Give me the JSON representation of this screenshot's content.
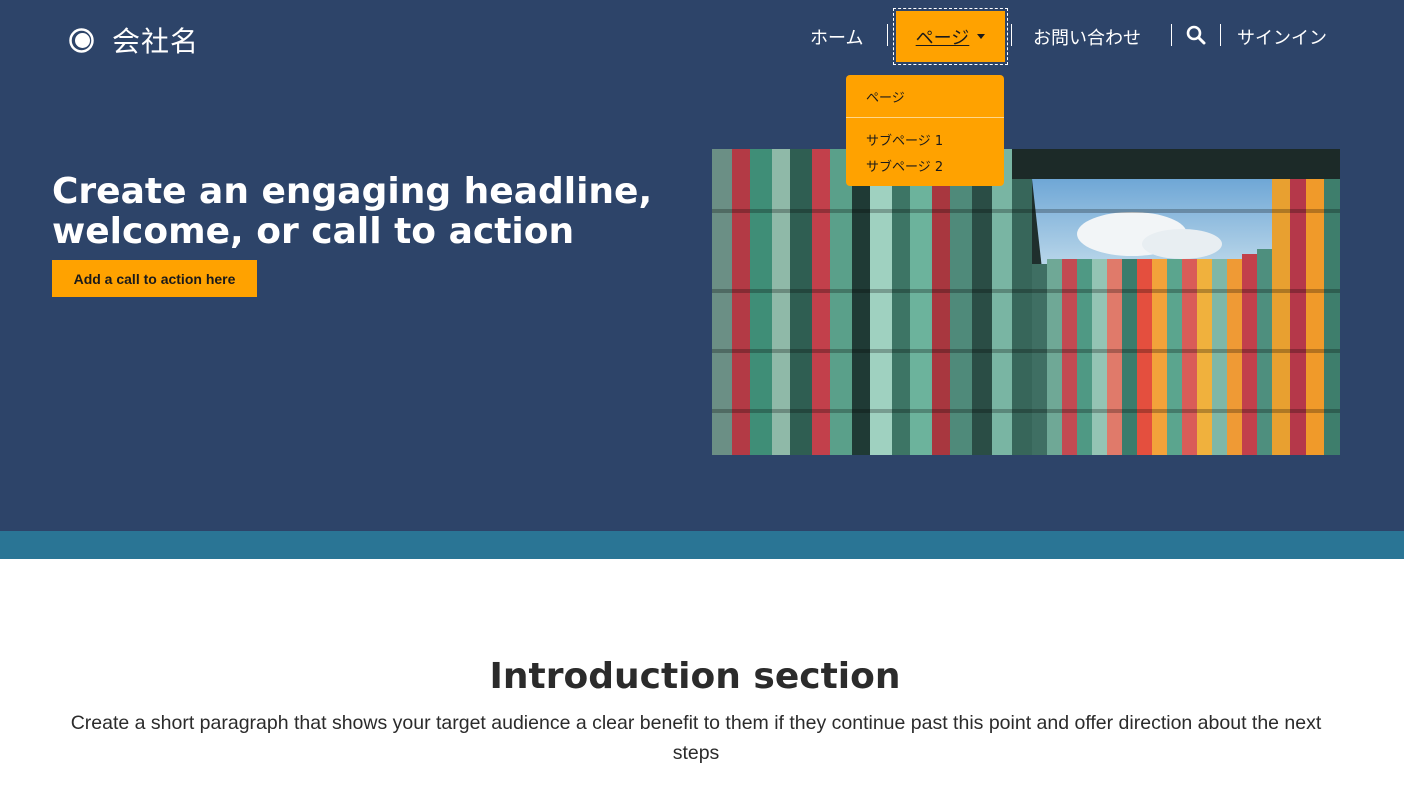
{
  "brand": {
    "name": "会社名",
    "icon": "circle-dot-icon"
  },
  "nav": {
    "home": "ホーム",
    "pages": "ページ",
    "contact": "お問い合わせ",
    "search_icon": "search-icon",
    "signin": "サインイン"
  },
  "dropdown": {
    "items": [
      "ページ",
      "サブページ 1",
      "サブページ 2"
    ]
  },
  "hero": {
    "headline": "Create an engaging headline, welcome, or call to action",
    "cta": "Add a call to action here"
  },
  "intro": {
    "title": "Introduction section",
    "text": "Create a short paragraph that shows your target audience a clear benefit to them if they continue past this point and offer direction about the next steps"
  },
  "colors": {
    "hero_bg": "#2d4469",
    "band": "#2a7595",
    "accent": "#ffa200"
  }
}
